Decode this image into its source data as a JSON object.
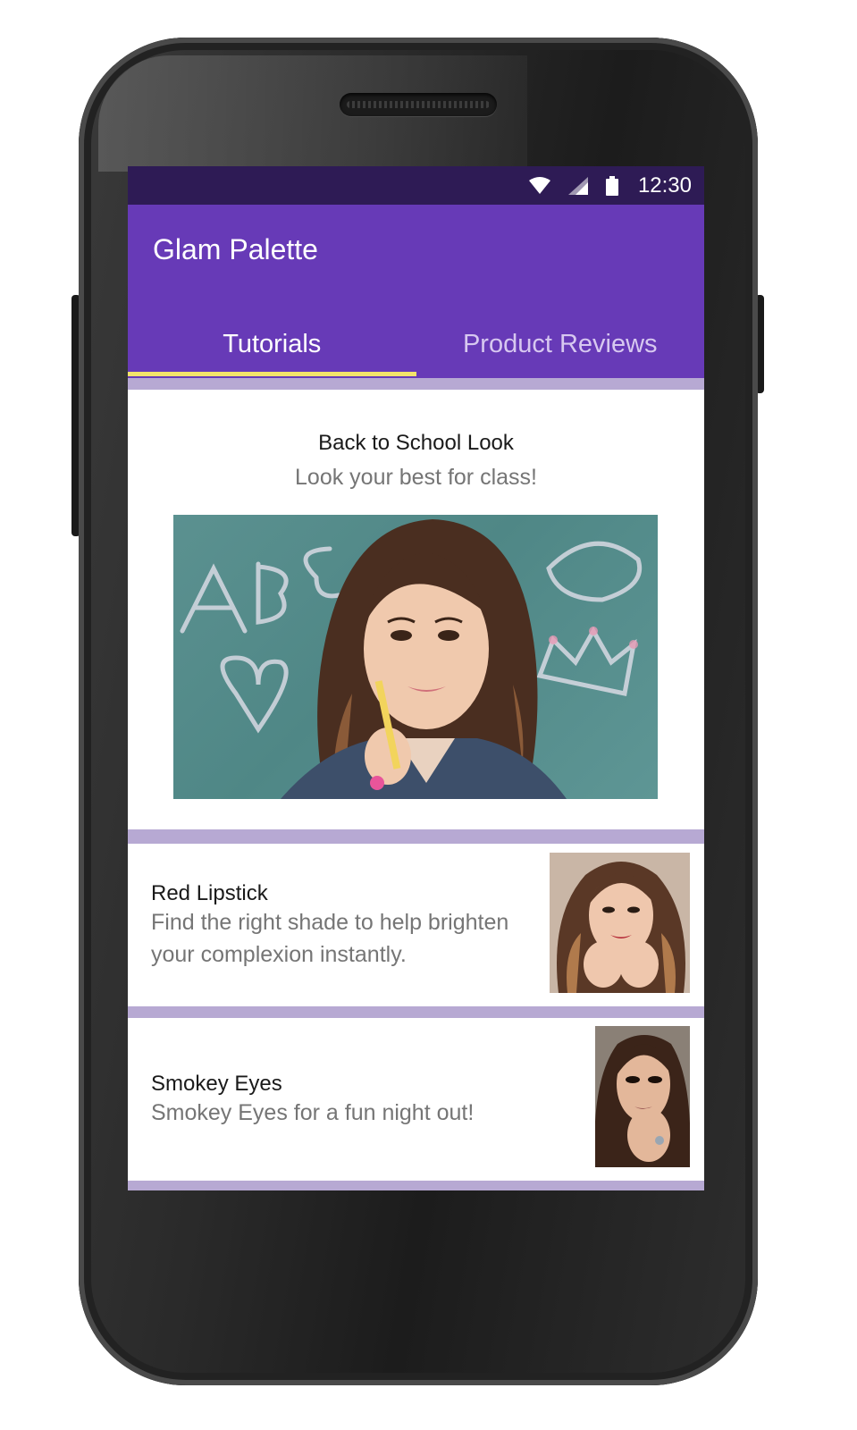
{
  "status_bar": {
    "time": "12:30",
    "icons": [
      "wifi-icon",
      "signal-icon",
      "battery-icon"
    ]
  },
  "app_bar": {
    "title": "Glam Palette"
  },
  "tabs": [
    {
      "label": "Tutorials",
      "selected": true
    },
    {
      "label": "Product Reviews",
      "selected": false
    }
  ],
  "featured": {
    "title": "Back to School Look",
    "subtitle": "Look your best for class!"
  },
  "articles": [
    {
      "title": "Red Lipstick",
      "description_lines": [
        "Find the right shade to help brighten",
        "your complexion instantly."
      ]
    },
    {
      "title": "Smokey Eyes",
      "description_lines": [
        "Smokey Eyes for a fun night out!"
      ]
    }
  ],
  "colors": {
    "status_bar": "#2e1b55",
    "primary": "#673ab7",
    "tab_indicator": "#f4e36b",
    "divider": "#b7a9d3"
  }
}
